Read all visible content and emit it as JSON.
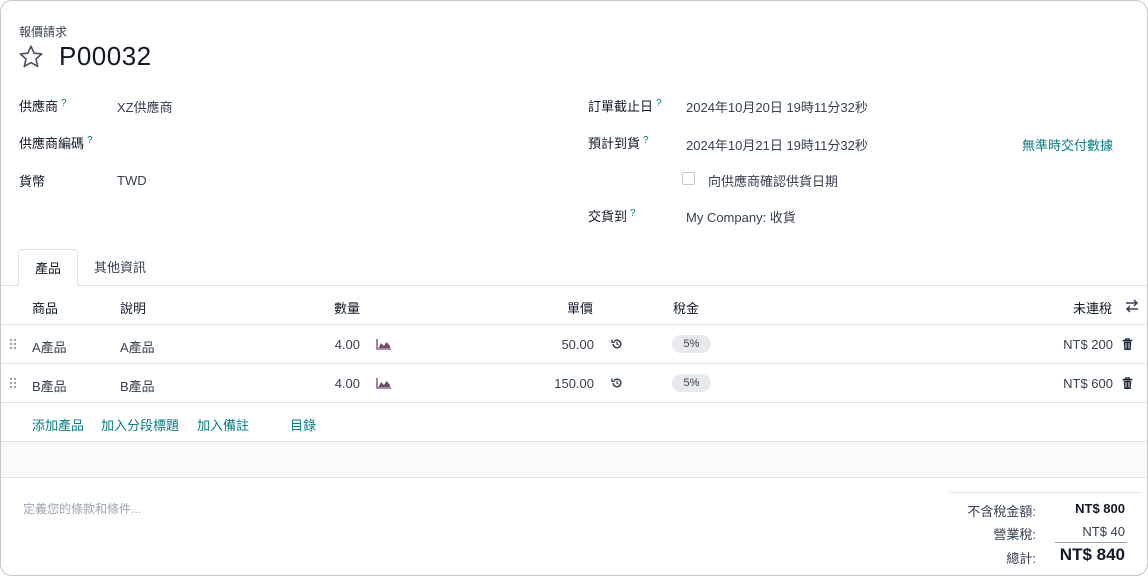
{
  "header": {
    "doc_type": "報價請求",
    "name": "P00032"
  },
  "fields_left": {
    "vendor_label": "供應商",
    "vendor_value": "XZ供應商",
    "vendor_ref_label": "供應商編碼",
    "vendor_ref_value": "",
    "currency_label": "貨幣",
    "currency_value": "TWD"
  },
  "fields_right": {
    "order_deadline_label": "訂單截止日",
    "order_deadline_value": "2024年10月20日 19時11分32秒",
    "expected_arrival_label": "預計到貨",
    "expected_arrival_value": "2024年10月21日 19時11分32秒",
    "on_time_link": "無準時交付數據",
    "confirm_receipt_label": "向供應商確認供貨日期",
    "deliver_to_label": "交貨到",
    "deliver_to_value": "My Company: 收貨"
  },
  "help_marker": "?",
  "tabs": [
    {
      "label": "產品",
      "active": true
    },
    {
      "label": "其他資訊",
      "active": false
    }
  ],
  "table": {
    "columns": {
      "product": "商品",
      "description": "說明",
      "quantity": "數量",
      "unit_price": "單價",
      "taxes": "稅金",
      "subtotal": "未連稅"
    },
    "rows": [
      {
        "product": "A產品",
        "description": "A產品",
        "quantity": "4.00",
        "unit_price": "50.00",
        "tax": "5%",
        "subtotal": "NT$ 200"
      },
      {
        "product": "B產品",
        "description": "B產品",
        "quantity": "4.00",
        "unit_price": "150.00",
        "tax": "5%",
        "subtotal": "NT$ 600"
      }
    ],
    "add_links": {
      "add_product": "添加產品",
      "add_section": "加入分段標題",
      "add_note": "加入備註",
      "catalog": "目錄"
    }
  },
  "notes": {
    "terms_placeholder": "定義您的條款和條件..."
  },
  "totals": {
    "untaxed_label": "不含稅金額:",
    "untaxed_value": "NT$ 800",
    "tax_label": "營業稅:",
    "tax_value": "NT$ 40",
    "total_label": "總計:",
    "total_value": "NT$ 840"
  },
  "colors": {
    "accent": "#017e84",
    "primary_icon": "#714b67",
    "border": "#dee2e6",
    "badge_bg": "#e7e9ed"
  },
  "icons": {
    "favorite": "star-outline-icon",
    "forecast": "area-chart-icon",
    "reset_price": "history-icon",
    "delete": "trash-icon",
    "optional_columns": "swap-arrows-icon",
    "drag": "drag-handle-icon"
  }
}
